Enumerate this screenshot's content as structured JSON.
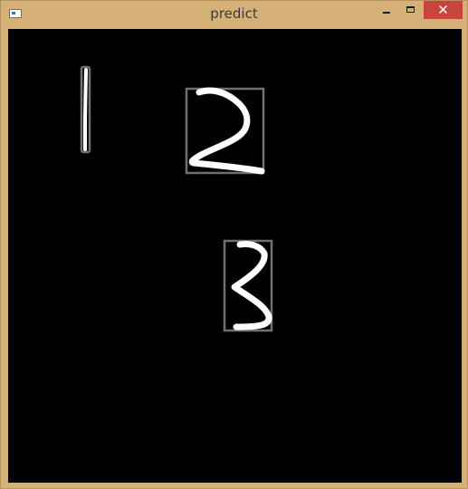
{
  "window": {
    "title": "predict",
    "close_glyph": "✕"
  },
  "icons": {
    "app": "app-window-icon",
    "minimize": "minimize-icon",
    "maximize": "maximize-icon",
    "close": "close-icon"
  },
  "colors": {
    "frame": "#d4b177",
    "canvas": "#000000",
    "stroke": "#ffffff",
    "bounding_box": "#707070",
    "close_button": "#c7453f"
  },
  "canvas": {
    "detections_count": 3
  }
}
